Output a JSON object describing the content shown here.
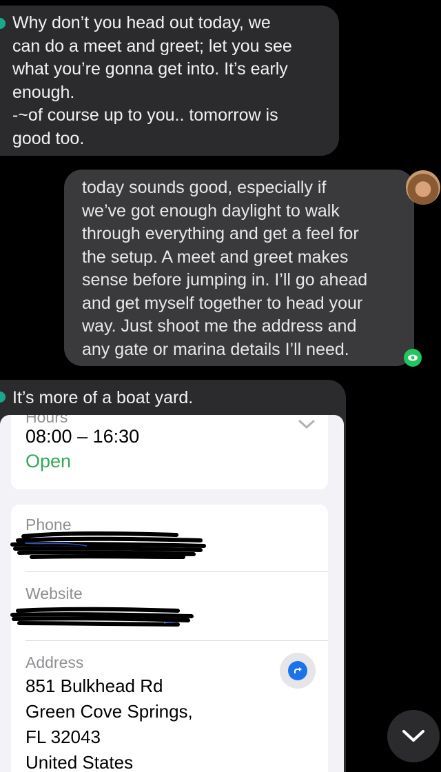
{
  "messages": {
    "incoming_1": {
      "lines": [
        "Why don’t you head out today, we",
        "can do a meet and greet; let you see",
        "what you’re gonna get into. It’s early",
        "enough.",
        "-~of course up to you.. tomorrow is",
        "good too."
      ]
    },
    "outgoing_1": {
      "lines": [
        "today sounds good, especially if",
        "we’ve got enough daylight to walk",
        "through everything and get a feel for",
        "the setup. A meet and greet makes",
        "sense before jumping in. I’ll go ahead",
        "and get myself together to head your",
        "way. Just shoot me the address and",
        "any gate or marina details I’ll need."
      ]
    },
    "incoming_2": {
      "text": "It’s more of a boat yard."
    }
  },
  "place_card": {
    "hours_label": "Hours",
    "hours_value": "08:00 – 16:30",
    "open_status": "Open",
    "phone_label": "Phone",
    "website_label": "Website",
    "address_label": "Address",
    "address_lines": [
      "851 Bulkhead Rd",
      "Green Cove Springs,",
      "FL 32043",
      "United States"
    ]
  },
  "colors": {
    "incoming_bubble": "#2b2b2d",
    "outgoing_bubble": "#3a3a3c",
    "open_green": "#34a853",
    "directions_blue": "#1a73e8",
    "seen_green": "#22c55e"
  },
  "icons": [
    "avatar",
    "seen-eye-icon",
    "chevron-down-icon",
    "directions-icon",
    "scroll-down-icon"
  ]
}
